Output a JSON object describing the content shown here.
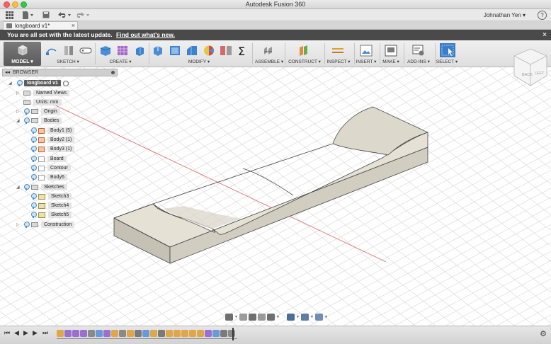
{
  "window": {
    "title": "Autodesk Fusion 360"
  },
  "appbar": {
    "user": "Johnathan Yen ▾",
    "help": "?"
  },
  "tab": {
    "label": "longboard v1*",
    "close": "×"
  },
  "banner": {
    "text": "You are all set with the latest update.",
    "link": "Find out what's new.",
    "close": "×"
  },
  "toolbar": {
    "model": "MODEL ▾",
    "groups": {
      "sketch": "SKETCH ▾",
      "create": "CREATE ▾",
      "modify": "MODIFY ▾",
      "assemble": "ASSEMBLE ▾",
      "construct": "CONSTRUCT ▾",
      "inspect": "INSPECT ▾",
      "insert": "INSERT ▾",
      "make": "MAKE ▾",
      "addins": "ADD-INS ▾",
      "select": "SELECT ▾"
    }
  },
  "browser": {
    "title": "BROWSER",
    "items": {
      "root": "longboard v1",
      "named_views": "Named Views",
      "units": "Units: mm",
      "origin": "Origin",
      "bodies": "Bodies",
      "body1": "Body1 (5)",
      "body2": "Body2 (1)",
      "body3": "Body3 (1)",
      "board": "Board",
      "contour": "Contour",
      "body6": "Body6",
      "sketches": "Sketches",
      "sketch3": "Sketch3",
      "sketch4": "Sketch4",
      "sketch5": "Sketch5",
      "construction": "Construction"
    }
  },
  "viewcube": {
    "face_front": "BACK",
    "face_right": "LEFT"
  },
  "colors": {
    "board_top": "#e6e1d5",
    "board_side": "#cfcabe",
    "grid": "#d7d7d7",
    "axis_red": "#d86464",
    "accent_blue": "#3a7dc9"
  }
}
